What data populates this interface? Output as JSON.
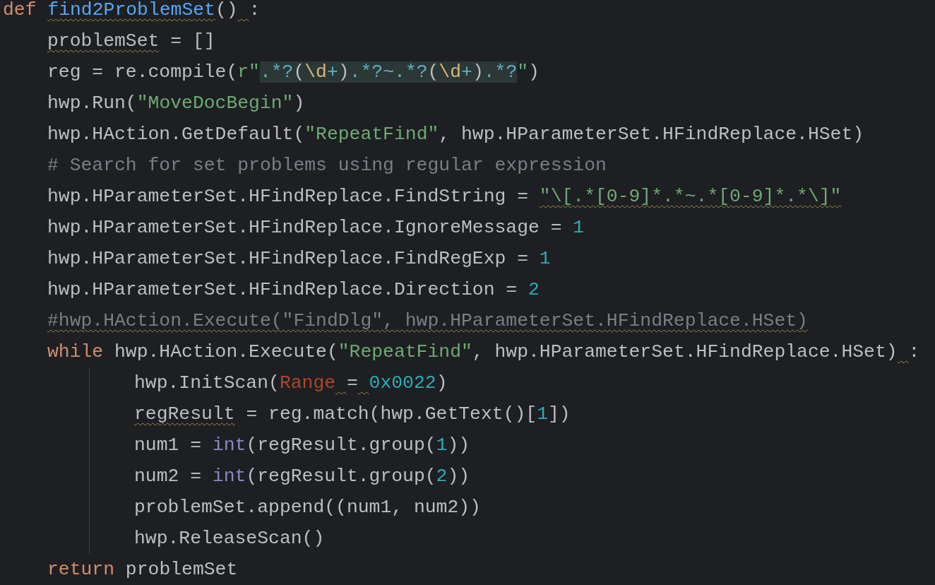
{
  "editor": {
    "lines": [
      {
        "tokens": [
          {
            "text": "def ",
            "kind": "keyword"
          },
          {
            "text": "find2ProblemSet",
            "kind": "function",
            "squiggle": true
          },
          {
            "text": "()",
            "kind": "plain"
          },
          {
            "text": " :",
            "kind": "plain",
            "squiggle_spaces": true
          }
        ],
        "children": [
          {
            "tokens": [
              {
                "text": "problemSet",
                "kind": "plain",
                "squiggle": true
              },
              {
                "text": " = []",
                "kind": "plain"
              }
            ]
          },
          {
            "tokens": [
              {
                "text": "reg = re.compile(",
                "kind": "plain"
              },
              {
                "text": "r\"",
                "kind": "string"
              },
              {
                "text": ".*?",
                "kind": "regex-op"
              },
              {
                "text": "(",
                "kind": "regex-paren"
              },
              {
                "text": "\\d",
                "kind": "regex-escape"
              },
              {
                "text": "+",
                "kind": "regex-op"
              },
              {
                "text": ")",
                "kind": "regex-paren"
              },
              {
                "text": ".*?~.*?",
                "kind": "regex-op"
              },
              {
                "text": "(",
                "kind": "regex-paren"
              },
              {
                "text": "\\d",
                "kind": "regex-escape"
              },
              {
                "text": "+",
                "kind": "regex-op"
              },
              {
                "text": ")",
                "kind": "regex-paren"
              },
              {
                "text": ".*?",
                "kind": "regex-op"
              },
              {
                "text": "\"",
                "kind": "string"
              },
              {
                "text": ")",
                "kind": "plain"
              }
            ]
          },
          {
            "tokens": [
              {
                "text": "hwp.Run(",
                "kind": "plain"
              },
              {
                "text": "\"MoveDocBegin\"",
                "kind": "string"
              },
              {
                "text": ")",
                "kind": "plain"
              }
            ]
          },
          {
            "tokens": [
              {
                "text": "hwp.HAction.GetDefault(",
                "kind": "plain"
              },
              {
                "text": "\"RepeatFind\"",
                "kind": "string"
              },
              {
                "text": ", hwp.HParameterSet.HFindReplace.HSet)",
                "kind": "plain"
              }
            ]
          },
          {
            "tokens": [
              {
                "text": "# Search for set problems using regular expression",
                "kind": "comment"
              }
            ]
          },
          {
            "tokens": [
              {
                "text": "hwp.HParameterSet.HFindReplace.FindString = ",
                "kind": "plain"
              },
              {
                "text": "\"\\[.*[0-9]*.*~.*[0-9]*.*\\]\"",
                "kind": "string",
                "squiggle": true
              }
            ]
          },
          {
            "tokens": [
              {
                "text": "hwp.HParameterSet.HFindReplace.IgnoreMessage = ",
                "kind": "plain"
              },
              {
                "text": "1",
                "kind": "number"
              }
            ]
          },
          {
            "tokens": [
              {
                "text": "hwp.HParameterSet.HFindReplace.FindRegExp = ",
                "kind": "plain"
              },
              {
                "text": "1",
                "kind": "number"
              }
            ]
          },
          {
            "tokens": [
              {
                "text": "hwp.HParameterSet.HFindReplace.Direction = ",
                "kind": "plain"
              },
              {
                "text": "2",
                "kind": "number"
              }
            ]
          },
          {
            "tokens": [
              {
                "text": "#hwp.HAction.Execute(\"FindDlg\", hwp.HParameterSet.HFindReplace.HSet)",
                "kind": "comment",
                "squiggle": true
              }
            ]
          },
          {
            "indent_guide": true,
            "tokens": [
              {
                "text": "while",
                "kind": "keyword"
              },
              {
                "text": " hwp.HAction.Execute(",
                "kind": "plain"
              },
              {
                "text": "\"RepeatFind\"",
                "kind": "string"
              },
              {
                "text": ", hwp.HParameterSet.HFindReplace.HSet)",
                "kind": "plain"
              },
              {
                "text": " :",
                "kind": "plain",
                "squiggle_spaces": true
              }
            ],
            "children": [
              {
                "tokens": [
                  {
                    "text": "hwp.InitScan(",
                    "kind": "plain"
                  },
                  {
                    "text": "Range",
                    "kind": "named-arg"
                  },
                  {
                    "text": " = ",
                    "kind": "plain",
                    "squiggle_spaces": true
                  },
                  {
                    "text": "0x0022",
                    "kind": "number"
                  },
                  {
                    "text": ")",
                    "kind": "plain"
                  }
                ]
              },
              {
                "tokens": [
                  {
                    "text": "regResult",
                    "kind": "plain",
                    "squiggle": true
                  },
                  {
                    "text": " = reg.match(hwp.GetText()[",
                    "kind": "plain"
                  },
                  {
                    "text": "1",
                    "kind": "number"
                  },
                  {
                    "text": "])",
                    "kind": "plain"
                  }
                ]
              },
              {
                "tokens": [
                  {
                    "text": "num1 = ",
                    "kind": "plain"
                  },
                  {
                    "text": "int",
                    "kind": "builtin"
                  },
                  {
                    "text": "(regResult.group(",
                    "kind": "plain"
                  },
                  {
                    "text": "1",
                    "kind": "number"
                  },
                  {
                    "text": "))",
                    "kind": "plain"
                  }
                ]
              },
              {
                "tokens": [
                  {
                    "text": "num2 = ",
                    "kind": "plain"
                  },
                  {
                    "text": "int",
                    "kind": "builtin"
                  },
                  {
                    "text": "(regResult.group(",
                    "kind": "plain"
                  },
                  {
                    "text": "2",
                    "kind": "number"
                  },
                  {
                    "text": "))",
                    "kind": "plain"
                  }
                ]
              },
              {
                "tokens": [
                  {
                    "text": "problemSet.append((num1, num2))",
                    "kind": "plain"
                  }
                ]
              },
              {
                "tokens": [
                  {
                    "text": "hwp.ReleaseScan()",
                    "kind": "plain"
                  }
                ]
              }
            ]
          },
          {
            "tokens": [
              {
                "text": "return",
                "kind": "keyword"
              },
              {
                "text": " problemSet",
                "kind": "plain"
              }
            ]
          }
        ]
      }
    ]
  }
}
